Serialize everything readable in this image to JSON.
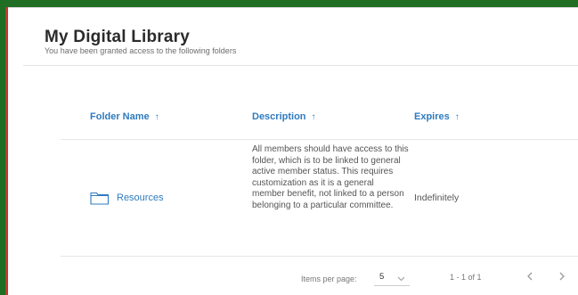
{
  "header": {
    "title": "My Digital Library",
    "subtitle": "You have been granted access to the following folders"
  },
  "table": {
    "columns": [
      {
        "label": "Folder Name",
        "sort_icon": "arrow-up-icon"
      },
      {
        "label": "Description",
        "sort_icon": "arrow-up-icon"
      },
      {
        "label": "Expires",
        "sort_icon": "arrow-up-icon"
      }
    ],
    "rows": [
      {
        "folder_name": "Resources",
        "icon": "folder-icon",
        "description": "All members should have access to this folder, which is to be linked to general active member status. This requires customization as it is a general member benefit, not linked to a person belonging to a particular committee.",
        "expires": "Indefinitely"
      }
    ]
  },
  "paginator": {
    "items_per_page_label": "Items per page:",
    "items_per_page_value": "5",
    "range_label": "1 - 1 of 1",
    "prev_icon": "chevron-left-icon",
    "next_icon": "chevron-right-icon"
  },
  "colors": {
    "accent": "#2f7bbf",
    "frame_green": "#1f6e23",
    "frame_red": "#c0392b"
  }
}
